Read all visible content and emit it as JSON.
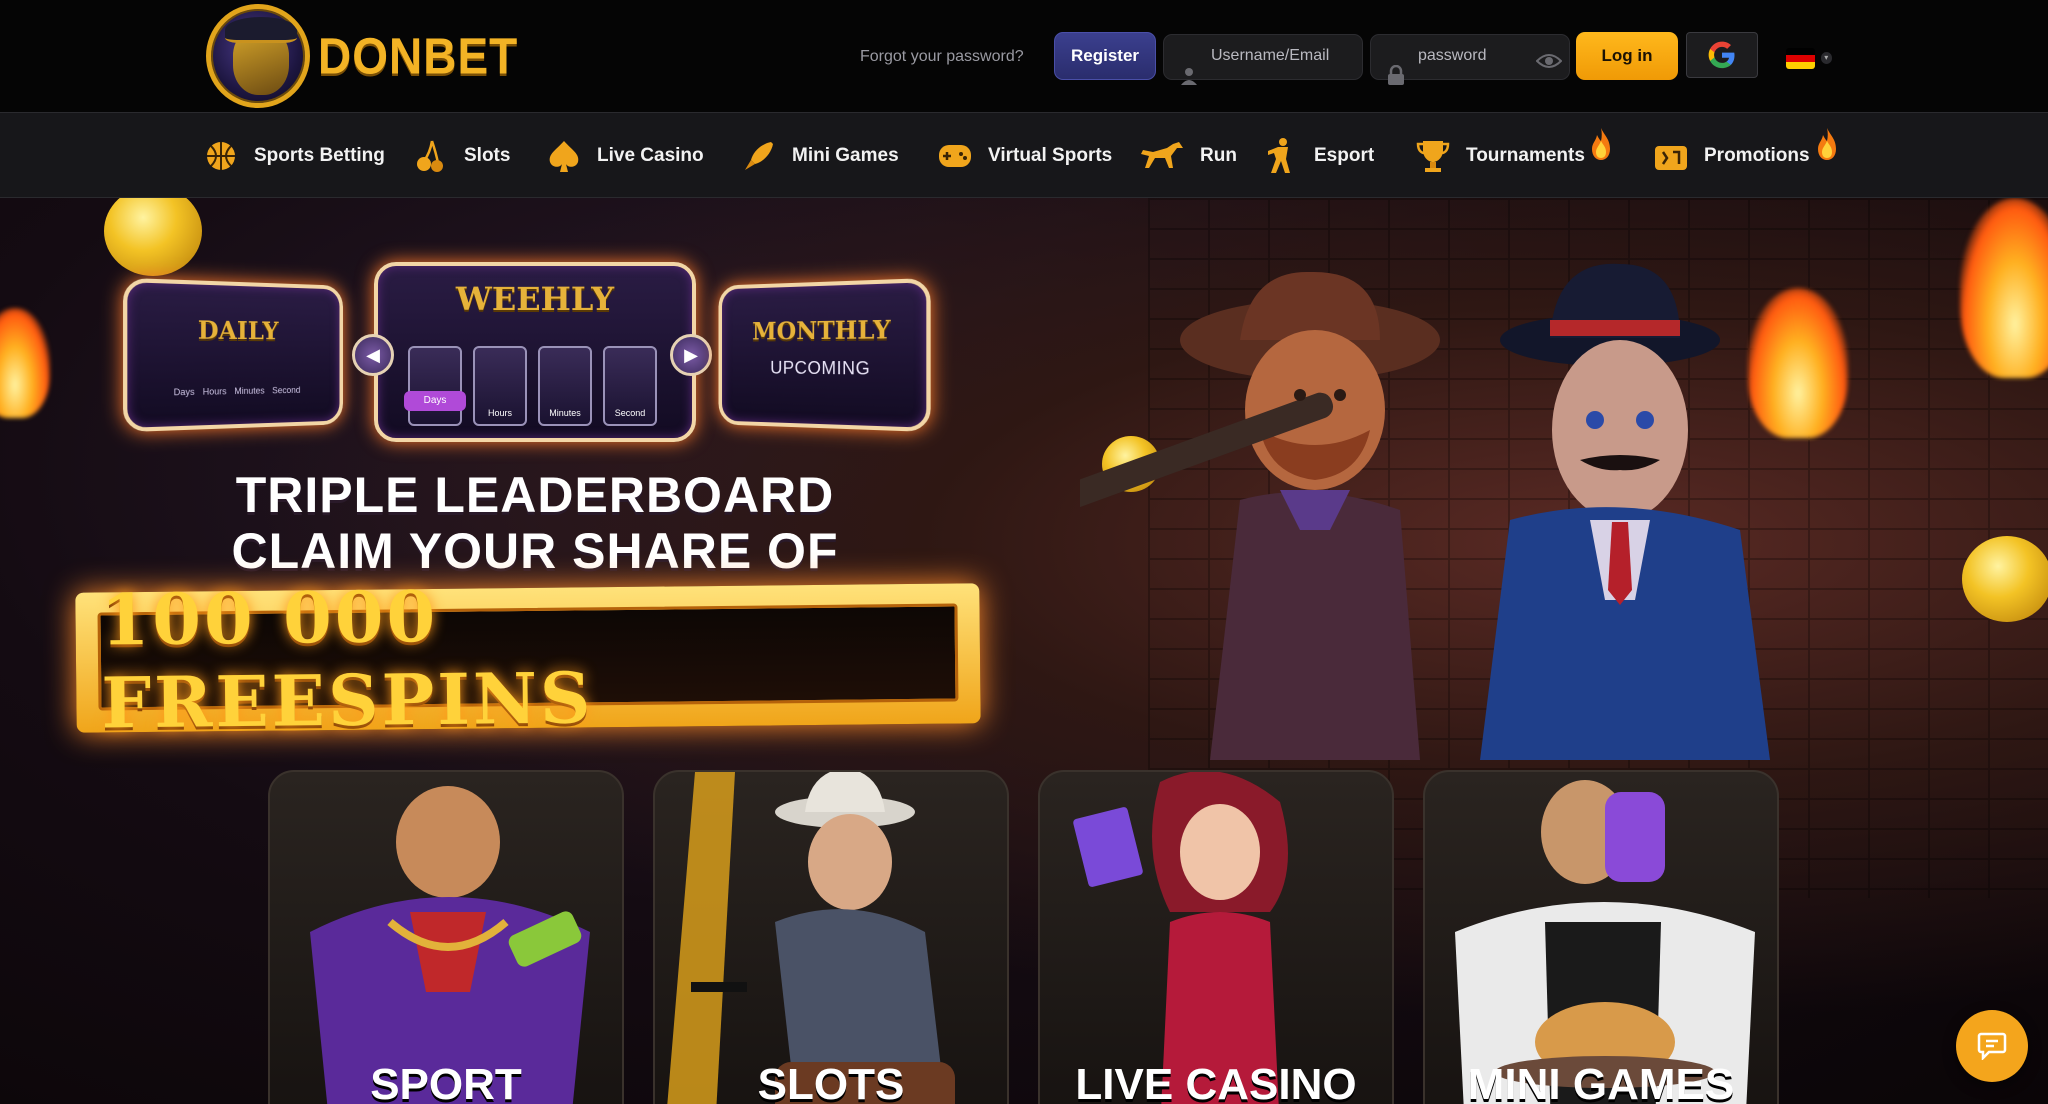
{
  "brand": {
    "name": "DONBET"
  },
  "header": {
    "forgot_password": "Forgot your password?",
    "register_label": "Register",
    "username_placeholder": "Username/Email",
    "password_placeholder": "password",
    "login_label": "Log in",
    "language": "de"
  },
  "nav": {
    "items": [
      {
        "label": "Sports Betting",
        "icon": "basketball-icon"
      },
      {
        "label": "Slots",
        "icon": "cherry-icon"
      },
      {
        "label": "Live Casino",
        "icon": "spade-icon"
      },
      {
        "label": "Mini Games",
        "icon": "rocket-icon"
      },
      {
        "label": "Virtual Sports",
        "icon": "gamepad-icon"
      },
      {
        "label": "Run",
        "icon": "horse-icon"
      },
      {
        "label": "Esport",
        "icon": "soldier-icon"
      },
      {
        "label": "Tournaments",
        "icon": "trophy-icon",
        "hot": true
      },
      {
        "label": "Promotions",
        "icon": "gift-icon",
        "hot": true
      }
    ]
  },
  "hero": {
    "leaderboards": {
      "daily": {
        "title": "DAILY",
        "units": [
          "Days",
          "Hours",
          "Minutes",
          "Second"
        ]
      },
      "weekly": {
        "title": "WEEHLY",
        "units": [
          "Days",
          "Hours",
          "Minutes",
          "Second"
        ]
      },
      "monthly": {
        "title": "MONTHLY",
        "status": "UPCOMING"
      }
    },
    "headline_line1": "TRIPLE LEADERBOARD",
    "headline_line2": "CLAIM YOUR SHARE OF",
    "banner": "100 000 FREESPINS"
  },
  "categories": [
    {
      "label": "SPORT"
    },
    {
      "label": "SLOTS"
    },
    {
      "label": "LIVE CASINO"
    },
    {
      "label": "MINI GAMES"
    }
  ],
  "colors": {
    "accent": "#f4a51c",
    "register": "#2f3380",
    "nav_bg": "#17171a"
  }
}
